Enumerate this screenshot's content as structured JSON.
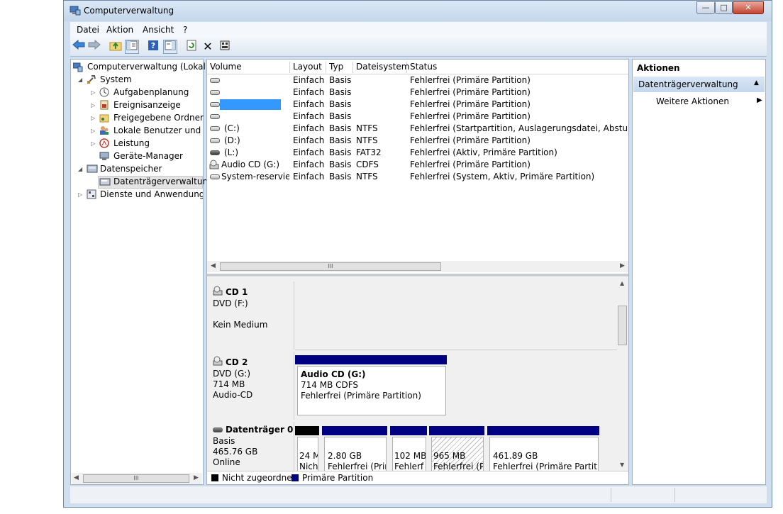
{
  "window": {
    "title": "Computerverwaltung",
    "controls": {
      "minimize": "—",
      "maximize": "□",
      "close": "✕"
    }
  },
  "menu": [
    "Datei",
    "Aktion",
    "Ansicht",
    "?"
  ],
  "tree": {
    "root": "Computerverwaltung (Lokal)",
    "system": "System",
    "aufgabenplanung": "Aufgabenplanung",
    "ereignisanzeige": "Ereignisanzeige",
    "freigegebene": "Freigegebene Ordner",
    "benutzer": "Lokale Benutzer und Gruppen",
    "leistung": "Leistung",
    "geraete": "Geräte-Manager",
    "datenspeicher": "Datenspeicher",
    "datentraeger": "Datenträgerverwaltung",
    "dienste": "Dienste und Anwendungen",
    "scroll_mark": "III"
  },
  "volume_table": {
    "headers": [
      "Volume",
      "Layout",
      "Typ",
      "Dateisystem",
      "Status"
    ],
    "rows": [
      {
        "volume": "",
        "layout": "Einfach",
        "typ": "Basis",
        "fs": "",
        "status": "Fehlerfrei (Primäre Partition)"
      },
      {
        "volume": "",
        "layout": "Einfach",
        "typ": "Basis",
        "fs": "",
        "status": "Fehlerfrei (Primäre Partition)"
      },
      {
        "volume": "",
        "layout": "Einfach",
        "typ": "Basis",
        "fs": "",
        "status": "Fehlerfrei (Primäre Partition)"
      },
      {
        "volume": "",
        "layout": "Einfach",
        "typ": "Basis",
        "fs": "",
        "status": "Fehlerfrei (Primäre Partition)"
      },
      {
        "volume": "(C:)",
        "layout": "Einfach",
        "typ": "Basis",
        "fs": "NTFS",
        "status": "Fehlerfrei (Startpartition, Auslagerungsdatei, Absturzabbild"
      },
      {
        "volume": "(D:)",
        "layout": "Einfach",
        "typ": "Basis",
        "fs": "NTFS",
        "status": "Fehlerfrei (Primäre Partition)"
      },
      {
        "volume": "(L:)",
        "layout": "Einfach",
        "typ": "Basis",
        "fs": "FAT32",
        "status": "Fehlerfrei (Aktiv, Primäre Partition)"
      },
      {
        "volume": "Audio CD (G:)",
        "layout": "Einfach",
        "typ": "Basis",
        "fs": "CDFS",
        "status": "Fehlerfrei (Primäre Partition)"
      },
      {
        "volume": "System-reserviert",
        "layout": "Einfach",
        "typ": "Basis",
        "fs": "NTFS",
        "status": "Fehlerfrei (System, Aktiv, Primäre Partition)"
      }
    ],
    "scroll_mark": "III"
  },
  "disks": {
    "cd1": {
      "name": "CD 1",
      "line1": "DVD (F:)",
      "line2": "Kein Medium"
    },
    "cd2": {
      "name": "CD 2",
      "line1": "DVD (G:)",
      "line2": "714 MB",
      "line3": "Audio-CD",
      "part_title": "Audio CD  (G:)",
      "part_size": "714 MB CDFS",
      "part_status": "Fehlerfrei (Primäre Partition)"
    },
    "disk0": {
      "name": "Datenträger 0",
      "line1": "Basis",
      "line2": "465.76 GB",
      "line3": "Online",
      "partitions": [
        {
          "size": "24 M",
          "status": "Nich"
        },
        {
          "size": "2.80 GB",
          "status": "Fehlerfrei (Prim"
        },
        {
          "size": "102 MB",
          "status": "Fehlerf"
        },
        {
          "size": "965 MB",
          "status": "Fehlerfrei (Pr"
        },
        {
          "size": "461.89 GB",
          "status": "Fehlerfrei (Primäre Partition"
        }
      ]
    }
  },
  "legend": {
    "unallocated": "Nicht zugeordnet",
    "primary": "Primäre Partition"
  },
  "actions": {
    "header": "Aktionen",
    "section": "Datenträgerverwaltung",
    "more": "Weitere Aktionen"
  },
  "colors": {
    "primary": "#000080",
    "unallocated": "#000000",
    "selection": "#3399ff"
  }
}
